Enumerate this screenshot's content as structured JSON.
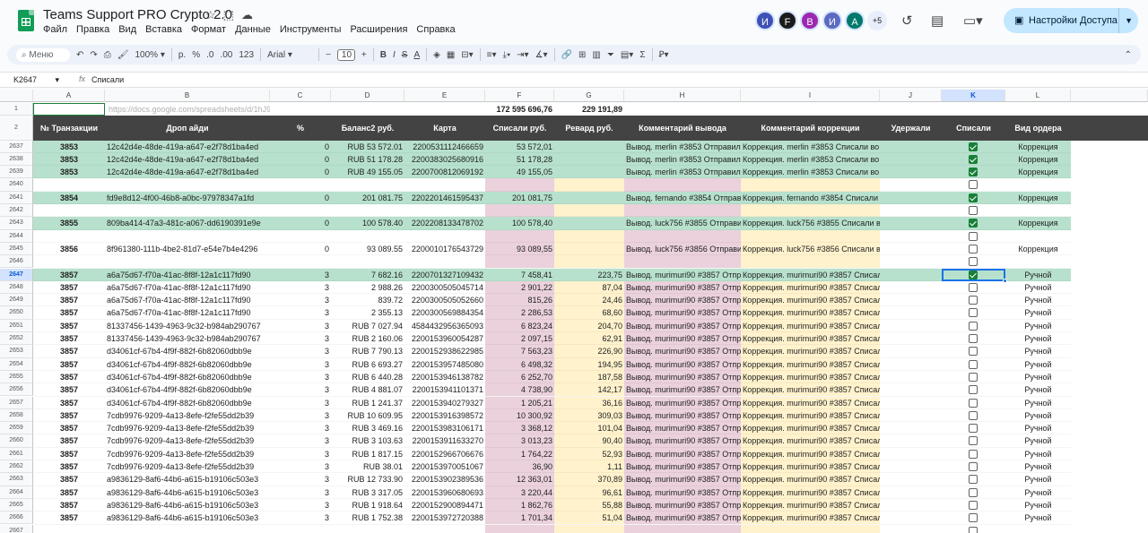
{
  "app": {
    "title": "Teams Support PRO Crypto 2.0"
  },
  "menu": [
    "Файл",
    "Правка",
    "Вид",
    "Вставка",
    "Формат",
    "Данные",
    "Инструменты",
    "Расширения",
    "Справка"
  ],
  "collaborators": [
    {
      "letter": "И",
      "color": "#3f51b5"
    },
    {
      "letter": "F",
      "color": "#1b1b1b"
    },
    {
      "letter": "В",
      "color": "#9c27b0"
    },
    {
      "letter": "И",
      "color": "#5c6bc0"
    },
    {
      "letter": "А",
      "color": "#00796b"
    }
  ],
  "collaborators_more": "+5",
  "share_label": "Настройки Доступа",
  "toolbar": {
    "search": "Меню",
    "zoom": "100%",
    "currency": "р.",
    "percent": "%",
    "dec_minus": ".0",
    "dec_plus": ".00",
    "num_format": "123",
    "font": "Arial",
    "font_size": "10",
    "bold": "B",
    "italic": "I",
    "strike": "S",
    "textcolor": "A"
  },
  "formula_bar": {
    "namebox": "K2647",
    "fx": "fx",
    "value": "Списали"
  },
  "columns": [
    "A",
    "B",
    "C",
    "D",
    "E",
    "F",
    "G",
    "H",
    "I",
    "J",
    "K",
    "L"
  ],
  "selected_column": "K",
  "row1": {
    "link": "https://docs.google.com/spreadsheets/d/1hJ9",
    "sum_f": "172 595 696,76",
    "sum_g": "229 191,89"
  },
  "headers": [
    "№ Транзакции",
    "Дроп айди",
    "%",
    "Баланс2 руб.",
    "Карта",
    "Списали руб.",
    "Ревард руб.",
    "Комментарий вывода",
    "Комментарий коррекции",
    "Удержали",
    "Списали",
    "Вид ордера"
  ],
  "selected_row": "2647",
  "rows": [
    {
      "n": "2637",
      "tx": "3853",
      "drop": "12c42d4e-48de-419a-a647-e2f78d1ba4ed",
      "pct": "0",
      "bal": "RUB 53 572.01",
      "card": "2200531112466659",
      "sp": "53 572,01",
      "rew": "",
      "cw": "Вывод. merlin #3853 Отправил",
      "cc": "Коррекция. merlin #3853 Списали во",
      "chk": true,
      "type": "Коррекция",
      "hl": true
    },
    {
      "n": "2638",
      "tx": "3853",
      "drop": "12c42d4e-48de-419a-a647-e2f78d1ba4ed",
      "pct": "0",
      "bal": "RUB 51 178.28",
      "card": "2200383025680916",
      "sp": "51 178,28",
      "rew": "",
      "cw": "Вывод. merlin #3853 Отправил",
      "cc": "Коррекция. merlin #3853 Списали во",
      "chk": true,
      "type": "Коррекция",
      "hl": true
    },
    {
      "n": "2639",
      "tx": "3853",
      "drop": "12c42d4e-48de-419a-a647-e2f78d1ba4ed",
      "pct": "0",
      "bal": "RUB 49 155.05",
      "card": "2200700812069192",
      "sp": "49 155,05",
      "rew": "",
      "cw": "Вывод. merlin #3853 Отправил",
      "cc": "Коррекция. merlin #3853 Списали во",
      "chk": true,
      "type": "Коррекция",
      "hl": true
    },
    {
      "n": "2640",
      "tx": "",
      "drop": "",
      "pct": "",
      "bal": "",
      "card": "",
      "sp": "",
      "rew": "",
      "cw": "",
      "cc": "",
      "chk": false,
      "type": "",
      "hl": false
    },
    {
      "n": "2641",
      "tx": "3854",
      "drop": "fd9e8d12-4f00-46b8-a0bc-97978347a1fd",
      "pct": "0",
      "bal": "201 081.75",
      "card": "2202201461595437",
      "sp": "201 081,75",
      "rew": "",
      "cw": "Вывод. fernando #3854 Отправ",
      "cc": "Коррекция. fernando #3854 Списали",
      "chk": true,
      "type": "Коррекция",
      "hl": true
    },
    {
      "n": "2642",
      "tx": "",
      "drop": "",
      "pct": "",
      "bal": "",
      "card": "",
      "sp": "",
      "rew": "",
      "cw": "",
      "cc": "",
      "chk": false,
      "type": "",
      "hl": false
    },
    {
      "n": "2643",
      "tx": "3855",
      "drop": "809ba414-47a3-481c-a067-dd6190391e9e",
      "pct": "0",
      "bal": "100 578.40",
      "card": "2202208133478702",
      "sp": "100 578,40",
      "rew": "",
      "cw": "Вывод. luck756 #3855 Отправи",
      "cc": "Коррекция. luck756 #3855 Списали в",
      "chk": true,
      "type": "Коррекция",
      "hl": true
    },
    {
      "n": "2644",
      "tx": "",
      "drop": "",
      "pct": "",
      "bal": "",
      "card": "",
      "sp": "",
      "rew": "",
      "cw": "",
      "cc": "",
      "chk": false,
      "type": "",
      "hl": false
    },
    {
      "n": "2645",
      "tx": "3856",
      "drop": "8f961380-111b-4be2-81d7-e54e7b4e4296",
      "pct": "0",
      "bal": "93 089.55",
      "card": "2200010176543729",
      "sp": "93 089,55",
      "rew": "",
      "cw": "Вывод. luck756 #3856 Отправи",
      "cc": "Коррекция. luck756 #3856 Списали в",
      "chk": false,
      "type": "Коррекция",
      "hl": false
    },
    {
      "n": "2646",
      "tx": "",
      "drop": "",
      "pct": "",
      "bal": "",
      "card": "",
      "sp": "",
      "rew": "",
      "cw": "",
      "cc": "",
      "chk": false,
      "type": "",
      "hl": false
    },
    {
      "n": "2647",
      "tx": "3857",
      "drop": "a6a75d67-f70a-41ac-8f8f-12a1c117fd90",
      "pct": "3",
      "bal": "7 682.16",
      "card": "2200701327109432",
      "sp": "7 458,41",
      "rew": "223,75",
      "cw": "Вывод. murimuri90 #3857 Отпр",
      "cc": "Коррекция. murimuri90 #3857 Списал",
      "chk": true,
      "type": "Ручной",
      "hl": true
    },
    {
      "n": "2648",
      "tx": "3857",
      "drop": "a6a75d67-f70a-41ac-8f8f-12a1c117fd90",
      "pct": "3",
      "bal": "2 988.26",
      "card": "2200300505045714",
      "sp": "2 901,22",
      "rew": "87,04",
      "cw": "Вывод. murimuri90 #3857 Отпр",
      "cc": "Коррекция. murimuri90 #3857 Списал",
      "chk": false,
      "type": "Ручной",
      "hl": false
    },
    {
      "n": "2649",
      "tx": "3857",
      "drop": "a6a75d67-f70a-41ac-8f8f-12a1c117fd90",
      "pct": "3",
      "bal": "839.72",
      "card": "2200300505052660",
      "sp": "815,26",
      "rew": "24,46",
      "cw": "Вывод. murimuri90 #3857 Отпр",
      "cc": "Коррекция. murimuri90 #3857 Списал",
      "chk": false,
      "type": "Ручной",
      "hl": false
    },
    {
      "n": "2650",
      "tx": "3857",
      "drop": "a6a75d67-f70a-41ac-8f8f-12a1c117fd90",
      "pct": "3",
      "bal": "2 355.13",
      "card": "2200300569884354",
      "sp": "2 286,53",
      "rew": "68,60",
      "cw": "Вывод. murimuri90 #3857 Отпр",
      "cc": "Коррекция. murimuri90 #3857 Списал",
      "chk": false,
      "type": "Ручной",
      "hl": false
    },
    {
      "n": "2651",
      "tx": "3857",
      "drop": "81337456-1439-4963-9c32-b984ab290767",
      "pct": "3",
      "bal": "RUB 7 027.94",
      "card": "4584432956365093",
      "sp": "6 823,24",
      "rew": "204,70",
      "cw": "Вывод. murimuri90 #3857 Отпр",
      "cc": "Коррекция. murimuri90 #3857 Списал",
      "chk": false,
      "type": "Ручной",
      "hl": false
    },
    {
      "n": "2652",
      "tx": "3857",
      "drop": "81337456-1439-4963-9c32-b984ab290767",
      "pct": "3",
      "bal": "RUB 2 160.06",
      "card": "2200153960054287",
      "sp": "2 097,15",
      "rew": "62,91",
      "cw": "Вывод. murimuri90 #3857 Отпр",
      "cc": "Коррекция. murimuri90 #3857 Списал",
      "chk": false,
      "type": "Ручной",
      "hl": false
    },
    {
      "n": "2653",
      "tx": "3857",
      "drop": "d34061cf-67b4-4f9f-882f-6b82060dbb9e",
      "pct": "3",
      "bal": "RUB 7 790.13",
      "card": "2200152938622985",
      "sp": "7 563,23",
      "rew": "226,90",
      "cw": "Вывод. murimuri90 #3857 Отпр",
      "cc": "Коррекция. murimuri90 #3857 Списал",
      "chk": false,
      "type": "Ручной",
      "hl": false
    },
    {
      "n": "2654",
      "tx": "3857",
      "drop": "d34061cf-67b4-4f9f-882f-6b82060dbb9e",
      "pct": "3",
      "bal": "RUB 6 693.27",
      "card": "2200153957485080",
      "sp": "6 498,32",
      "rew": "194,95",
      "cw": "Вывод. murimuri90 #3857 Отпр",
      "cc": "Коррекция. murimuri90 #3857 Списал",
      "chk": false,
      "type": "Ручной",
      "hl": false
    },
    {
      "n": "2655",
      "tx": "3857",
      "drop": "d34061cf-67b4-4f9f-882f-6b82060dbb9e",
      "pct": "3",
      "bal": "RUB 6 440.28",
      "card": "2200153946138782",
      "sp": "6 252,70",
      "rew": "187,58",
      "cw": "Вывод. murimuri90 #3857 Отпр",
      "cc": "Коррекция. murimuri90 #3857 Списал",
      "chk": false,
      "type": "Ручной",
      "hl": false
    },
    {
      "n": "2656",
      "tx": "3857",
      "drop": "d34061cf-67b4-4f9f-882f-6b82060dbb9e",
      "pct": "3",
      "bal": "RUB 4 881.07",
      "card": "2200153941101371",
      "sp": "4 738,90",
      "rew": "142,17",
      "cw": "Вывод. murimuri90 #3857 Отпр",
      "cc": "Коррекция. murimuri90 #3857 Списал",
      "chk": false,
      "type": "Ручной",
      "hl": false
    },
    {
      "n": "2657",
      "tx": "3857",
      "drop": "d34061cf-67b4-4f9f-882f-6b82060dbb9e",
      "pct": "3",
      "bal": "RUB 1 241.37",
      "card": "2200153940279327",
      "sp": "1 205,21",
      "rew": "36,16",
      "cw": "Вывод. murimuri90 #3857 Отпр",
      "cc": "Коррекция. murimuri90 #3857 Списал",
      "chk": false,
      "type": "Ручной",
      "hl": false
    },
    {
      "n": "2658",
      "tx": "3857",
      "drop": "7cdb9976-9209-4a13-8efe-f2fe55dd2b39",
      "pct": "3",
      "bal": "RUB 10 609.95",
      "card": "2200153916398572",
      "sp": "10 300,92",
      "rew": "309,03",
      "cw": "Вывод. murimuri90 #3857 Отпр",
      "cc": "Коррекция. murimuri90 #3857 Списал",
      "chk": false,
      "type": "Ручной",
      "hl": false
    },
    {
      "n": "2659",
      "tx": "3857",
      "drop": "7cdb9976-9209-4a13-8efe-f2fe55dd2b39",
      "pct": "3",
      "bal": "RUB 3 469.16",
      "card": "2200153983106171",
      "sp": "3 368,12",
      "rew": "101,04",
      "cw": "Вывод. murimuri90 #3857 Отпр",
      "cc": "Коррекция. murimuri90 #3857 Списал",
      "chk": false,
      "type": "Ручной",
      "hl": false
    },
    {
      "n": "2660",
      "tx": "3857",
      "drop": "7cdb9976-9209-4a13-8efe-f2fe55dd2b39",
      "pct": "3",
      "bal": "RUB 3 103.63",
      "card": "2200153911633270",
      "sp": "3 013,23",
      "rew": "90,40",
      "cw": "Вывод. murimuri90 #3857 Отпр",
      "cc": "Коррекция. murimuri90 #3857 Списал",
      "chk": false,
      "type": "Ручной",
      "hl": false
    },
    {
      "n": "2661",
      "tx": "3857",
      "drop": "7cdb9976-9209-4a13-8efe-f2fe55dd2b39",
      "pct": "3",
      "bal": "RUB 1 817.15",
      "card": "2200152966706676",
      "sp": "1 764,22",
      "rew": "52,93",
      "cw": "Вывод. murimuri90 #3857 Отпр",
      "cc": "Коррекция. murimuri90 #3857 Списал",
      "chk": false,
      "type": "Ручной",
      "hl": false
    },
    {
      "n": "2662",
      "tx": "3857",
      "drop": "7cdb9976-9209-4a13-8efe-f2fe55dd2b39",
      "pct": "3",
      "bal": "RUB 38.01",
      "card": "2200153970051067",
      "sp": "36,90",
      "rew": "1,11",
      "cw": "Вывод. murimuri90 #3857 Отпр",
      "cc": "Коррекция. murimuri90 #3857 Списал",
      "chk": false,
      "type": "Ручной",
      "hl": false
    },
    {
      "n": "2663",
      "tx": "3857",
      "drop": "a9836129-8af6-44b6-a615-b19106c503e3",
      "pct": "3",
      "bal": "RUB 12 733.90",
      "card": "2200153902389536",
      "sp": "12 363,01",
      "rew": "370,89",
      "cw": "Вывод. murimuri90 #3857 Отпр",
      "cc": "Коррекция. murimuri90 #3857 Списал",
      "chk": false,
      "type": "Ручной",
      "hl": false
    },
    {
      "n": "2664",
      "tx": "3857",
      "drop": "a9836129-8af6-44b6-a615-b19106c503e3",
      "pct": "3",
      "bal": "RUB 3 317.05",
      "card": "2200153960680693",
      "sp": "3 220,44",
      "rew": "96,61",
      "cw": "Вывод. murimuri90 #3857 Отпр",
      "cc": "Коррекция. murimuri90 #3857 Списал",
      "chk": false,
      "type": "Ручной",
      "hl": false
    },
    {
      "n": "2665",
      "tx": "3857",
      "drop": "a9836129-8af6-44b6-a615-b19106c503e3",
      "pct": "3",
      "bal": "RUB 1 918.64",
      "card": "2200152900894471",
      "sp": "1 862,76",
      "rew": "55,88",
      "cw": "Вывод. murimuri90 #3857 Отпр",
      "cc": "Коррекция. murimuri90 #3857 Списал",
      "chk": false,
      "type": "Ручной",
      "hl": false
    },
    {
      "n": "2666",
      "tx": "3857",
      "drop": "a9836129-8af6-44b6-a615-b19106c503e3",
      "pct": "3",
      "bal": "RUB 1 752.38",
      "card": "2200153972720388",
      "sp": "1 701,34",
      "rew": "51,04",
      "cw": "Вывод. murimuri90 #3857 Отпр",
      "cc": "Коррекция. murimuri90 #3857 Списал",
      "chk": false,
      "type": "Ручной",
      "hl": false
    },
    {
      "n": "2667",
      "tx": "",
      "drop": "",
      "pct": "",
      "bal": "",
      "card": "",
      "sp": "",
      "rew": "",
      "cw": "",
      "cc": "",
      "chk": false,
      "type": "",
      "hl": false
    }
  ],
  "colors": {
    "row_highlight": "#b7e1cd",
    "col_spisali": "#ead1dc",
    "col_reward": "#fff2cc",
    "col_comment": "#ead1dc",
    "col_correction": "#fff2cc",
    "header_dark": "#434343",
    "checkbox_on": "#188038",
    "selection": "#1a73e8"
  }
}
